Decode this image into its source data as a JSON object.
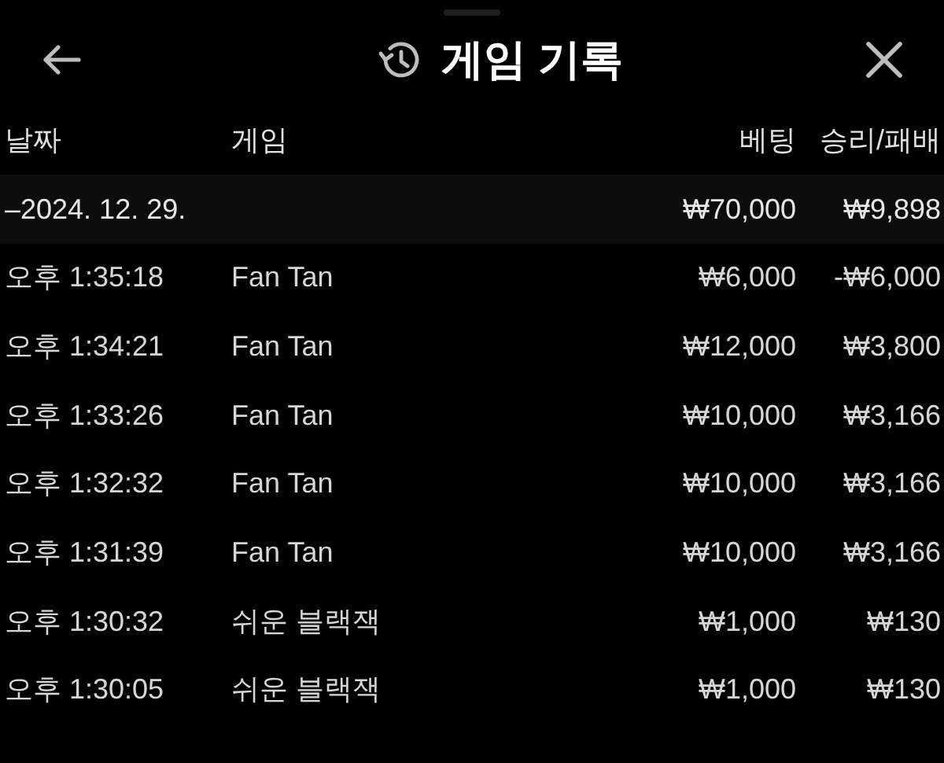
{
  "header": {
    "title": "게임 기록"
  },
  "table": {
    "columns": [
      "날짜",
      "게임",
      "베팅",
      "승리/패배"
    ],
    "group": {
      "date": "–2024. 12. 29.",
      "bet": "₩70,000",
      "result": "₩9,898"
    },
    "rows": [
      {
        "time": "오후 1:35:18",
        "game": "Fan Tan",
        "bet": "₩6,000",
        "result": "-₩6,000"
      },
      {
        "time": "오후 1:34:21",
        "game": "Fan Tan",
        "bet": "₩12,000",
        "result": "₩3,800"
      },
      {
        "time": "오후 1:33:26",
        "game": "Fan Tan",
        "bet": "₩10,000",
        "result": "₩3,166"
      },
      {
        "time": "오후 1:32:32",
        "game": "Fan Tan",
        "bet": "₩10,000",
        "result": "₩3,166"
      },
      {
        "time": "오후 1:31:39",
        "game": "Fan Tan",
        "bet": "₩10,000",
        "result": "₩3,166"
      },
      {
        "time": "오후 1:30:32",
        "game": "쉬운 블랙잭",
        "bet": "₩1,000",
        "result": "₩130"
      },
      {
        "time": "오후 1:30:05",
        "game": "쉬운 블랙잭",
        "bet": "₩1,000",
        "result": "₩130"
      }
    ]
  }
}
